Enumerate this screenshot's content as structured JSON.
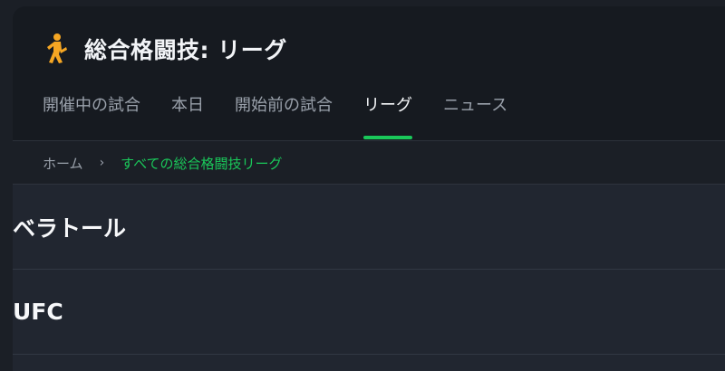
{
  "header": {
    "title": "総合格闘技: リーグ",
    "icon": "fighter-icon",
    "accent_color": "#f5a623"
  },
  "tabs": [
    {
      "label": "開催中の試合",
      "active": false
    },
    {
      "label": "本日",
      "active": false
    },
    {
      "label": "開始前の試合",
      "active": false
    },
    {
      "label": "リーグ",
      "active": true
    },
    {
      "label": "ニュース",
      "active": false
    }
  ],
  "breadcrumb": {
    "home": "ホーム",
    "separator": "›",
    "current": "すべての総合格闘技リーグ"
  },
  "leagues": [
    {
      "name": "ベラトール"
    },
    {
      "name": "UFC"
    }
  ],
  "colors": {
    "active_tab_indicator": "#1ac85a",
    "breadcrumb_current": "#1ac85a",
    "background": "#1b1f26"
  }
}
